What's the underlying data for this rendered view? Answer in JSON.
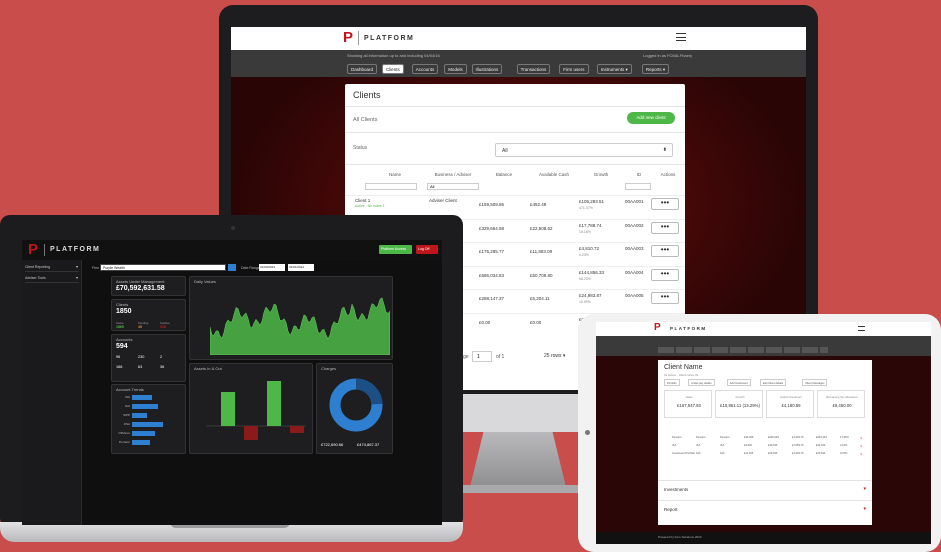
{
  "imac": {
    "brand": "PLATFORM",
    "info_text": "Showing all information up to and including 04/04/16",
    "login_text": "Logged in as FCMA-Fhaery",
    "nav": [
      "Dashboard",
      "Clients",
      "Accounts",
      "Models",
      "Illustrations",
      "Transactions",
      "Firm users",
      "Instruments ▾",
      "Reports ▾"
    ],
    "active_nav": "Clients",
    "page_title": "Clients",
    "section_title": "All Clients",
    "add_button": "Add new client",
    "status_label": "Status",
    "status_value": "All",
    "columns": [
      "Name",
      "Business / Adviser",
      "Balance",
      "Available Cash",
      "Growth",
      "ID",
      "Actions"
    ],
    "adviser_filter": "All",
    "rows": [
      {
        "name": "Client 1",
        "sub": "Active · No notes 1",
        "adviser": "Adviser Client",
        "balance": "£159,509.85",
        "cash": "£452.48",
        "growth": "£105,283.51",
        "growth_pct": "471.37%",
        "id": "00AA001"
      },
      {
        "name": "",
        "sub": "",
        "adviser": "Client",
        "balance": "£329,664.58",
        "cash": "£22,508.62",
        "growth": "£17,788.74",
        "growth_pct": "15.16%",
        "id": "00AA002"
      },
      {
        "name": "",
        "sub": "",
        "adviser": "nt",
        "balance": "£175,285.77",
        "cash": "£11,883.09",
        "growth": "£4,810.72",
        "growth_pct": "0.23%",
        "id": "00AA003"
      },
      {
        "name": "",
        "sub": "",
        "adviser": "ent",
        "balance": "£586,034.83",
        "cash": "£50,709.80",
        "growth": "£144,856.33",
        "growth_pct": "98.23%",
        "id": "00AA004"
      },
      {
        "name": "",
        "sub": "",
        "adviser": "ent",
        "balance": "£288,147.37",
        "cash": "£5,204.11",
        "growth": "£24,983.87",
        "growth_pct": "10.99%",
        "id": "00AA005"
      },
      {
        "name": "",
        "sub": "",
        "adviser": "ent",
        "balance": "£0.00",
        "cash": "£0.00",
        "growth": "£0.00",
        "growth_pct": "0.0%",
        "id": "00AA006"
      }
    ],
    "actions_glyph": "•••",
    "page_label": "Page",
    "page_value": "1",
    "page_of": "of 1",
    "rows_label": "25 rows"
  },
  "laptop": {
    "brand": "PLATFORM",
    "platform_access": "Platform Access",
    "logoff": "Log Off",
    "sidebar": [
      "Client Reporting",
      "Adviser Tools"
    ],
    "firm_label": "Firm",
    "firm_value": "Purple Wealth",
    "date_label": "Date Range",
    "date_from": "31/03/2023",
    "date_to": "01/01/2024",
    "aum_label": "Assets Under Management",
    "aum_value": "£70,592,631.58",
    "clients_label": "Clients",
    "clients_value": "1850",
    "clients_breakdown": [
      {
        "l": "Active",
        "v": "1865"
      },
      {
        "l": "Pending",
        "v": "49"
      },
      {
        "l": "Inactive",
        "v": "518"
      }
    ],
    "accounts_label": "Accounts",
    "accounts_value": "594",
    "accounts_grid": [
      [
        "96",
        "230",
        "2"
      ],
      [
        "168",
        "63",
        "36"
      ]
    ],
    "account_trends_label": "Account Trends",
    "daily_values_label": "Daily Values",
    "assets_label": "Assets In & Out",
    "charges_label": "Charges",
    "charges_left": "£722,690.66",
    "charges_right": "£474,867.37",
    "trends_rows": [
      {
        "l": "ISA",
        "w": 40
      },
      {
        "l": "GIA",
        "w": 52
      },
      {
        "l": "SIPP",
        "w": 30
      },
      {
        "l": "JISA",
        "w": 62
      },
      {
        "l": "Offshore",
        "w": 46
      },
      {
        "l": "Pension",
        "w": 36
      }
    ]
  },
  "tablet": {
    "brand": "PLATFORM",
    "client_name": "Client Name",
    "client_sub": "01 Active · Client since 01",
    "tabs": [
      "Portfolio",
      "Under-pay details",
      "Add Investment",
      "Edit Client details",
      "Client Messages"
    ],
    "stats": [
      {
        "l": "Value",
        "v": "£167,947.93"
      },
      {
        "l": "Growth",
        "v": "£10,861.11 (13.29%)"
      },
      {
        "l": "Gains/Investment",
        "v": "£4,180.89"
      },
      {
        "l": "Remaining Tax Allowance",
        "v": "£9,450.00"
      }
    ],
    "sections": [
      "Investments",
      "Report"
    ],
    "table_rows": [
      [
        "Pension",
        "Pension",
        "Pension",
        "£34,009",
        "£200,033",
        "£1,003.70",
        "£263,334",
        "17.35%"
      ],
      [
        "ISA",
        "ISA",
        "ISA",
        "£3,600",
        "£49,033",
        "£7,083.70",
        "£24,042",
        "4.10%"
      ],
      [
        "Investment Portfolio",
        "GIA",
        "GIA",
        "£11,303",
        "£29,033",
        "£1,003.70",
        "£23,634",
        "0.07%"
      ]
    ],
    "footer": "Powered by Fero Solutions 2023"
  },
  "colors": {
    "background": "#c94d4b",
    "brand_red": "#c0161b",
    "green": "#4db848",
    "accent_blue": "#2f7fd0"
  }
}
